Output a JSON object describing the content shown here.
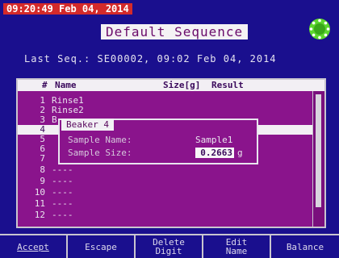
{
  "header": {
    "clock": "09:20:49 Feb 04, 2014",
    "title": "Default Sequence",
    "last_sequence": "Last Seq.: SE00002, 09:02 Feb 04, 2014"
  },
  "list": {
    "columns": {
      "number": "#",
      "name": "Name",
      "size": "Size[g]",
      "result": "Result"
    },
    "rows": [
      {
        "num": "1",
        "name": "Rinse1"
      },
      {
        "num": "2",
        "name": "Rinse2"
      },
      {
        "num": "3",
        "name": "B"
      },
      {
        "num": "4",
        "name": ""
      },
      {
        "num": "5",
        "name": ""
      },
      {
        "num": "6",
        "name": ""
      },
      {
        "num": "7",
        "name": ""
      },
      {
        "num": "8",
        "name": "----"
      },
      {
        "num": "9",
        "name": "----"
      },
      {
        "num": "10",
        "name": "----"
      },
      {
        "num": "11",
        "name": "----"
      },
      {
        "num": "12",
        "name": "----"
      }
    ],
    "selected_row": 4
  },
  "dialog": {
    "title": "Beaker 4",
    "sample_name_label": "Sample Name:",
    "sample_name_value": "Sample1",
    "sample_size_label": "Sample Size:",
    "sample_size_value": "0.2663",
    "sample_size_unit": "g"
  },
  "softkeys": {
    "accept": "Accept",
    "escape": "Escape",
    "delete_digit": "Delete\nDigit",
    "edit_name": "Edit\nName",
    "balance": "Balance"
  },
  "colors": {
    "background": "#1a0f8e",
    "panel": "#8a148c",
    "clock_bg": "#d42a2a",
    "status_led": "#5cd62e"
  },
  "icons": {
    "status": "gear-status-icon"
  }
}
